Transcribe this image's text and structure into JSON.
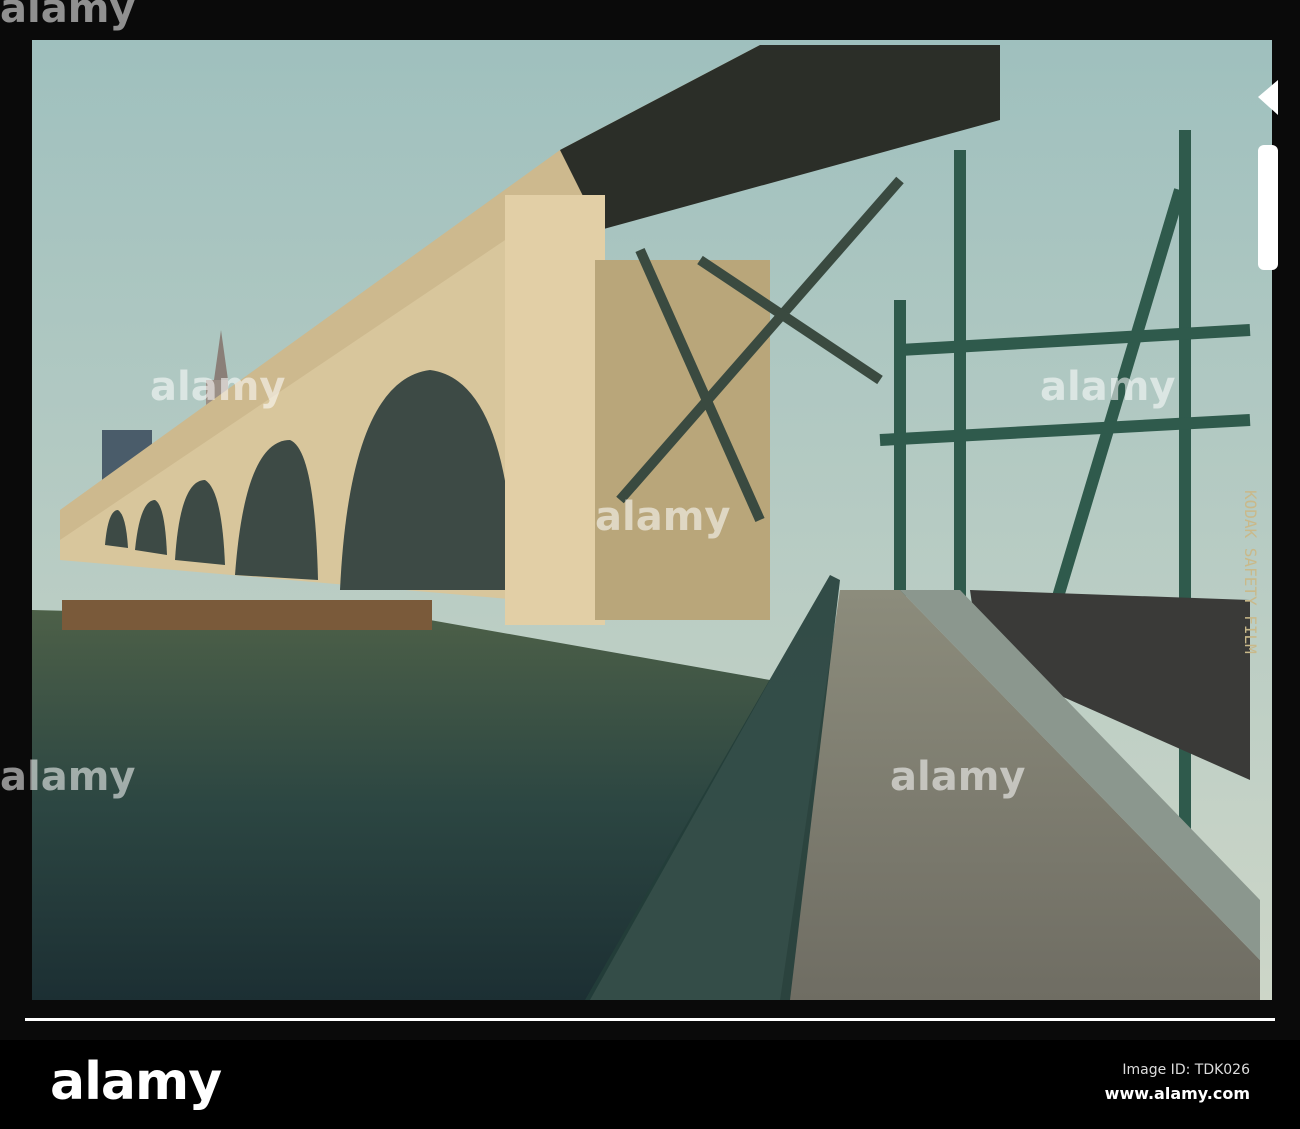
{
  "watermark": {
    "brand": "alamy"
  },
  "film_edge_text": "KODAK SAFETY FILM",
  "footer": {
    "logo": "alamy",
    "image_id": "Image ID: TDK026",
    "url": "www.alamy.com"
  },
  "colors": {
    "sky": "#a9c6c4",
    "water": "#2e4a44",
    "steel": "#2f5a4c",
    "concrete": "#d9c7a0"
  }
}
